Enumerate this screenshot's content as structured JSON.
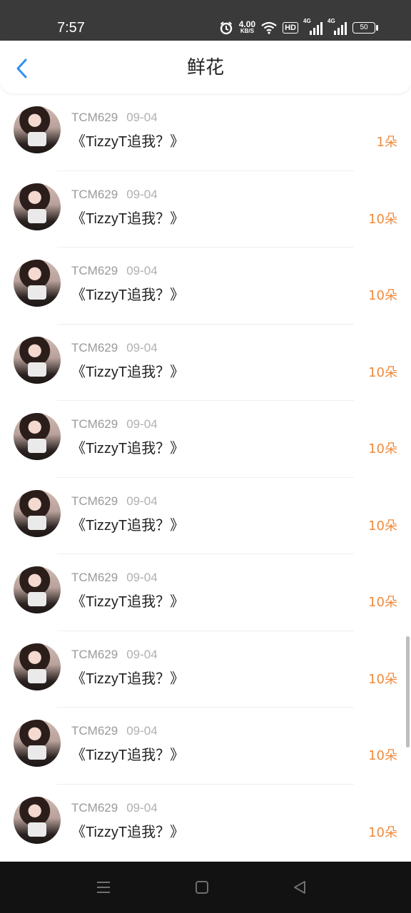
{
  "status_bar": {
    "time": "7:57",
    "net_speed_value": "4.00",
    "net_speed_unit": "KB/S",
    "hd_label": "HD",
    "signal1_label": "4G",
    "signal2_label": "4G",
    "battery": "50",
    "icons": [
      "alarm-icon",
      "wifi-icon",
      "hd-icon",
      "signal-icon",
      "signal-icon",
      "battery-icon"
    ]
  },
  "header": {
    "title": "鲜花",
    "back_icon": "chevron-left-icon",
    "accent_color": "#2f8ff0"
  },
  "list": {
    "count_color": "#f08a3c",
    "items": [
      {
        "user": "TCM629",
        "date": "09-04",
        "title": "《TizzyT追我？》",
        "count": "1朵"
      },
      {
        "user": "TCM629",
        "date": "09-04",
        "title": "《TizzyT追我？》",
        "count": "10朵"
      },
      {
        "user": "TCM629",
        "date": "09-04",
        "title": "《TizzyT追我？》",
        "count": "10朵"
      },
      {
        "user": "TCM629",
        "date": "09-04",
        "title": "《TizzyT追我？》",
        "count": "10朵"
      },
      {
        "user": "TCM629",
        "date": "09-04",
        "title": "《TizzyT追我？》",
        "count": "10朵"
      },
      {
        "user": "TCM629",
        "date": "09-04",
        "title": "《TizzyT追我？》",
        "count": "10朵"
      },
      {
        "user": "TCM629",
        "date": "09-04",
        "title": "《TizzyT追我？》",
        "count": "10朵"
      },
      {
        "user": "TCM629",
        "date": "09-04",
        "title": "《TizzyT追我？》",
        "count": "10朵"
      },
      {
        "user": "TCM629",
        "date": "09-04",
        "title": "《TizzyT追我？》",
        "count": "10朵"
      },
      {
        "user": "TCM629",
        "date": "09-04",
        "title": "《TizzyT追我？》",
        "count": "10朵"
      }
    ]
  },
  "nav_bar": {
    "icons": [
      "menu-icon",
      "home-square-icon",
      "back-triangle-icon"
    ]
  }
}
